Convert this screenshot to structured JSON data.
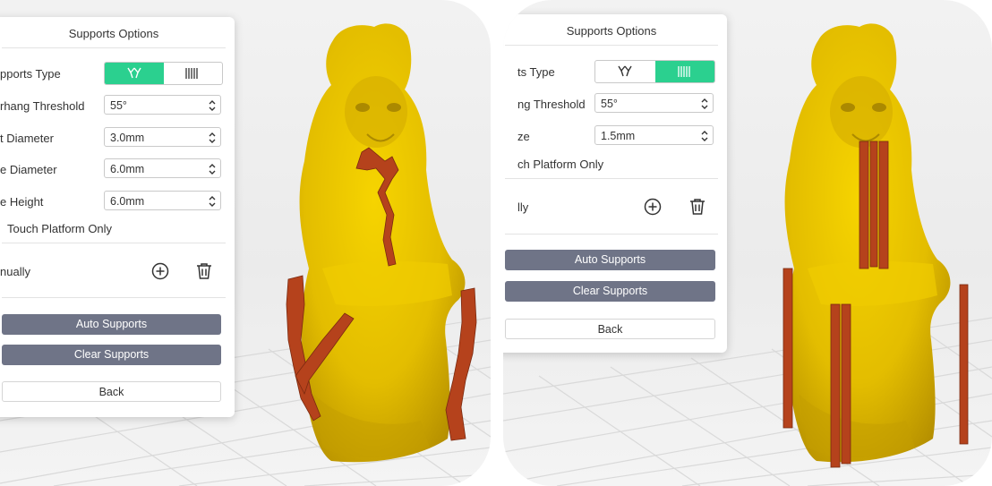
{
  "left": {
    "panel": {
      "title": "Supports Options",
      "supports_type_label": "pports Type",
      "overhang_label": "rhang Threshold",
      "overhang_value": "55°",
      "diameter1_label": "t Diameter",
      "diameter1_value": "3.0mm",
      "diameter2_label": "e Diameter",
      "diameter2_value": "6.0mm",
      "height_label": "e Height",
      "height_value": "6.0mm",
      "touch_platform_label": "Touch Platform Only",
      "manually_label": "nually",
      "auto_supports": "Auto Supports",
      "clear_supports": "Clear Supports",
      "back": "Back",
      "active_type": "tree"
    }
  },
  "right": {
    "panel": {
      "title": "Supports Options",
      "supports_type_label": "ts Type",
      "overhang_label": "ng Threshold",
      "overhang_value": "55°",
      "size_label": "ze",
      "size_value": "1.5mm",
      "touch_platform_label": "ch Platform Only",
      "manually_label": "lly",
      "auto_supports": "Auto Supports",
      "clear_supports": "Clear Supports",
      "back": "Back",
      "active_type": "linear"
    }
  },
  "colors": {
    "accent_green": "#2bd08f",
    "button_grey": "#6f7487",
    "model_yellow": "#e8c200",
    "support_red": "#b5421c"
  }
}
